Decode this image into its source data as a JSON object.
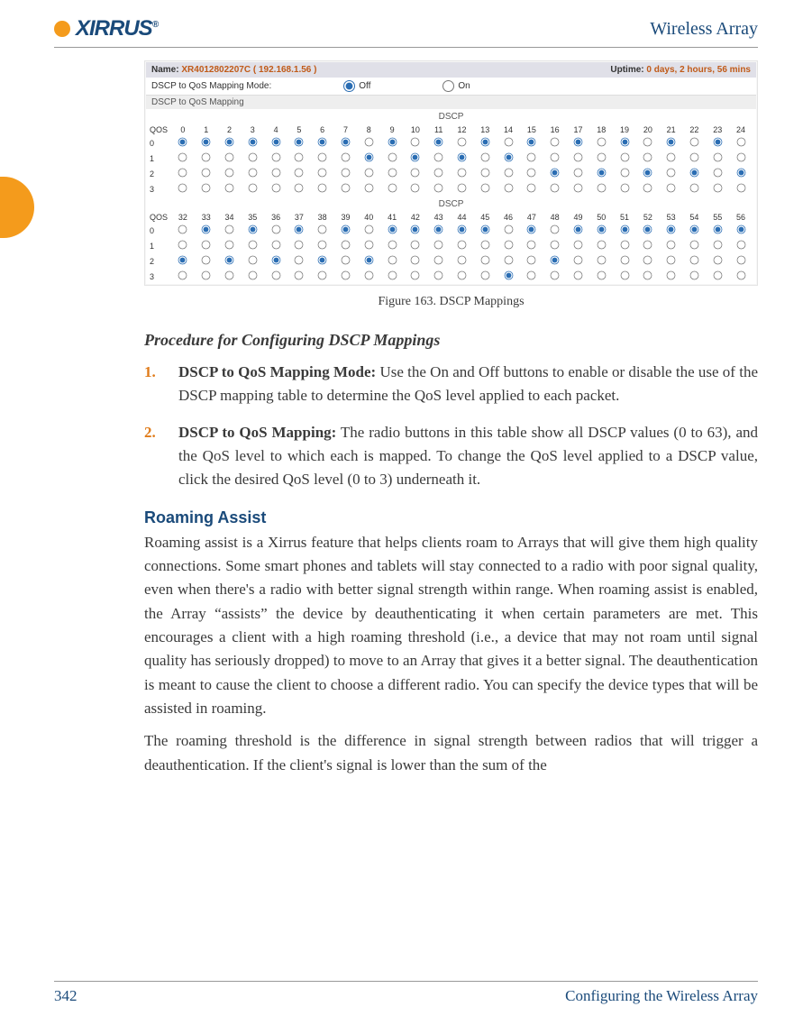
{
  "header": {
    "doc_title": "Wireless Array"
  },
  "figure": {
    "name_label": "Name:",
    "name_value": "XR4012802207C   ( 192.168.1.56 )",
    "uptime_label": "Uptime:",
    "uptime_value": "0 days, 2 hours, 56 mins",
    "mode_label": "DSCP to QoS Mapping Mode:",
    "mode_off": "Off",
    "mode_on": "On",
    "section_label": "DSCP to QoS Mapping",
    "dscp_label": "DSCP",
    "qos_label": "QOS",
    "caption": "Figure 163. DSCP Mappings",
    "rows1": [
      "0",
      "1",
      "2",
      "3",
      "4",
      "5",
      "6",
      "7",
      "8",
      "9",
      "10",
      "11",
      "12",
      "13",
      "14",
      "15",
      "16",
      "17",
      "18",
      "19",
      "20",
      "21",
      "22",
      "23",
      "24"
    ],
    "rows2": [
      "32",
      "33",
      "34",
      "35",
      "36",
      "37",
      "38",
      "39",
      "40",
      "41",
      "42",
      "43",
      "44",
      "45",
      "46",
      "47",
      "48",
      "49",
      "50",
      "51",
      "52",
      "53",
      "54",
      "55",
      "56"
    ],
    "qos_levels": [
      "0",
      "1",
      "2",
      "3"
    ],
    "selected1": {
      "0": 0,
      "1": 0,
      "2": 0,
      "3": 0,
      "4": 0,
      "5": 0,
      "6": 0,
      "7": 0,
      "8": 1,
      "9": 0,
      "10": 1,
      "11": 0,
      "12": 1,
      "13": 0,
      "14": 1,
      "15": 0,
      "16": 2,
      "17": 0,
      "18": 2,
      "19": 0,
      "20": 2,
      "21": 0,
      "22": 2,
      "23": 0,
      "24": 2
    },
    "selected2": {
      "32": 2,
      "33": 0,
      "34": 2,
      "35": 0,
      "36": 2,
      "37": 0,
      "38": 2,
      "39": 0,
      "40": 2,
      "41": 0,
      "42": 0,
      "43": 0,
      "44": 0,
      "45": 0,
      "46": 3,
      "47": 0,
      "48": 2,
      "49": 0,
      "50": 0,
      "51": 0,
      "52": 0,
      "53": 0,
      "54": 0,
      "55": 0,
      "56": 0
    }
  },
  "proc_heading": "Procedure for Configuring DSCP Mappings",
  "proc": [
    {
      "num": "1.",
      "label": "DSCP to QoS Mapping Mode:",
      "text": " Use the On and Off buttons to enable or disable the use of the DSCP mapping table to determine the QoS level applied to each packet."
    },
    {
      "num": "2.",
      "label": "DSCP to QoS Mapping:",
      "text": " The radio buttons in this table show all DSCP values (0 to 63), and the QoS level to which each is mapped. To change the QoS level applied to a DSCP value, click the desired QoS level (0 to 3) underneath it."
    }
  ],
  "roaming_heading": "Roaming Assist",
  "roaming_p1": "Roaming assist is a Xirrus feature that helps clients roam to Arrays that will give them high quality connections. Some smart phones and tablets will stay connected to a radio with poor signal quality, even when there's a radio with better signal strength within range. When roaming assist is enabled, the Array “assists” the device by deauthenticating it when certain parameters are met. This encourages a client with a high roaming threshold (i.e., a device that may not roam until signal quality has seriously dropped) to move to an Array that gives it a better signal. The deauthentication is meant to cause the client to choose a different radio. You can specify the device types that will be assisted in roaming.",
  "roaming_p2": "The roaming threshold is the difference in signal strength between radios that will trigger a deauthentication. If the client's signal is lower than the sum of the",
  "footer": {
    "page": "342",
    "section": "Configuring the Wireless Array"
  }
}
